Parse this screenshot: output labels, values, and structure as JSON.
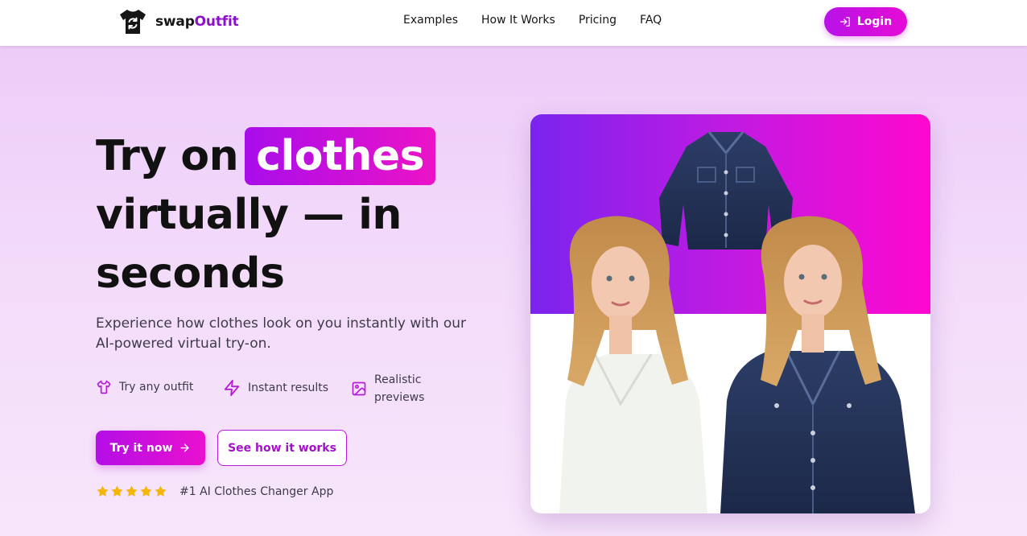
{
  "brand": {
    "name_part1": "swap",
    "name_part2": "Outfit",
    "logo_icon": "tshirt-swap-icon"
  },
  "nav": {
    "links": [
      "Examples",
      "How It Works",
      "Pricing",
      "FAQ"
    ],
    "login_label": "Login",
    "login_icon": "login-icon"
  },
  "hero": {
    "title_prefix": "Try on",
    "title_highlight": "clothes",
    "title_line2": "virtually — in",
    "title_line3": "seconds",
    "subtitle": "Experience how clothes look on you instantly with our AI-powered virtual try-on.",
    "features": [
      {
        "icon": "shirt-icon",
        "label": "Try any outfit"
      },
      {
        "icon": "lightning-icon",
        "label": "Instant results"
      },
      {
        "icon": "image-icon",
        "label": "Realistic previews"
      }
    ],
    "primary_cta": "Try it now",
    "secondary_cta": "See how it works",
    "rating_stars": 5,
    "rating_text": "#1 AI Clothes Changer App"
  },
  "colors": {
    "accent": "#c20fe0",
    "accent_end": "#ea10d0",
    "brand_purple": "#8b10c9",
    "star": "#f5b50f",
    "image_gradient_start": "#7a24ee",
    "image_gradient_end": "#ff08cf"
  }
}
